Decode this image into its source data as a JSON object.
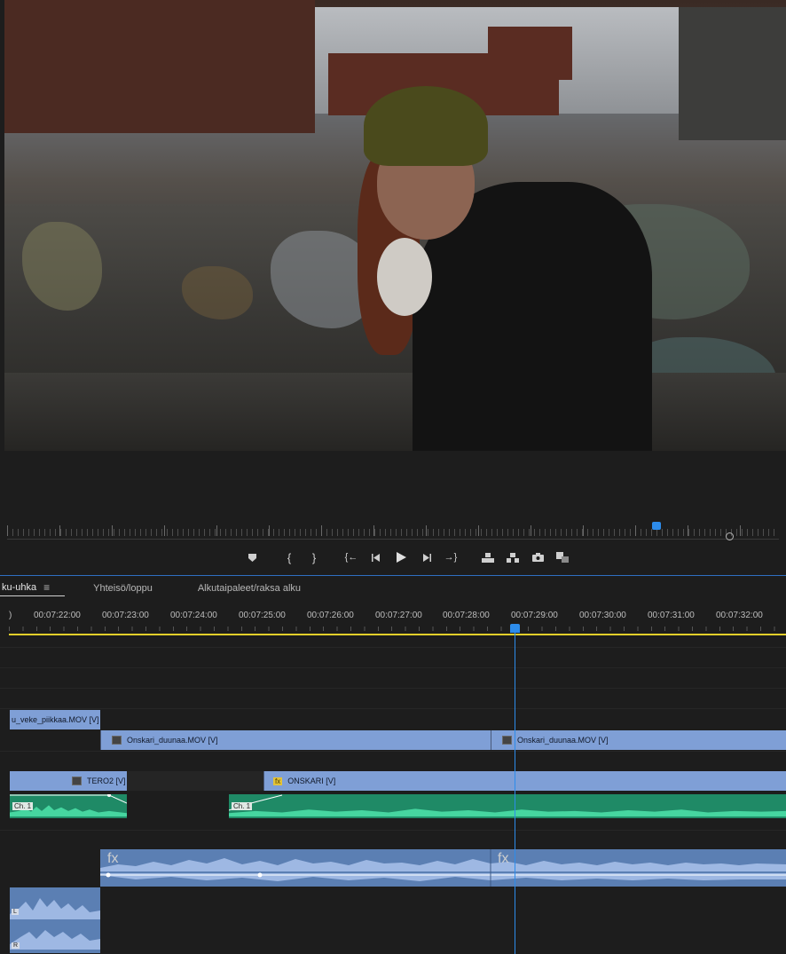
{
  "monitor": {
    "description": ""
  },
  "transport": {
    "buttons": [
      "add-marker",
      "mark-in",
      "mark-out",
      "go-to-in",
      "step-back",
      "play",
      "step-forward",
      "go-to-out",
      "lift",
      "extract",
      "export-frame",
      "compare"
    ]
  },
  "tabs": [
    {
      "label": "ku-uhka",
      "active": true
    },
    {
      "label": "Yhteisö/loppu",
      "active": false
    },
    {
      "label": "Alkutaipaleet/raksa alku",
      "active": false
    }
  ],
  "ruler": {
    "timecodes": [
      "00:07:22:00",
      "00:07:23:00",
      "00:07:24:00",
      "00:07:25:00",
      "00:07:26:00",
      "00:07:27:00",
      "00:07:28:00",
      "00:07:29:00",
      "00:07:30:00",
      "00:07:31:00",
      "00:07:32:00"
    ],
    "left_partial": ")"
  },
  "video_clips": {
    "v3_clip1": "u_veke_piikkaa.MOV [V]",
    "v2_clip1": "Onskari_duunaa.MOV [V]",
    "v2_clip2": "Onskari_duunaa.MOV [V]",
    "v1_clip1": "TERO2 [V]",
    "v1_clip2": "ONSKARI [V]"
  },
  "audio": {
    "ch1_a": "Ch. 1",
    "ch1_b": "Ch. 1",
    "fx_label": "fx",
    "left_channel": "L",
    "right_channel": "R"
  },
  "colors": {
    "video_clip": "#7f9fd6",
    "audio_green": "#1f8a66",
    "audio_blue": "#5b7fb3",
    "playhead": "#2d8ceb",
    "work_area": "#e2cf2a",
    "fx_badge": "#e3c337"
  }
}
